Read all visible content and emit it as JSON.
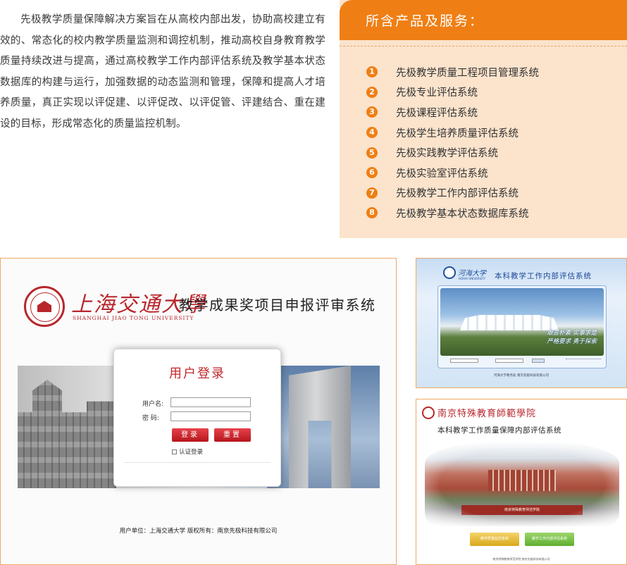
{
  "intro": {
    "text": "先极教学质量保障解决方案旨在从高校内部出发，协助高校建立有效的、常态化的校内教学质量监测和调控机制，推动高校自身教育教学质量持续改进与提高，通过高校教学工作内部评估系统及教学基本状态数据库的构建与运行，加强数据的动态监测和管理，保障和提高人才培养质量，真正实现以评促建、以评促改、以评促管、评建结合、重在建设的目标，形成常态化的质量监控机制。"
  },
  "products": {
    "heading": "所含产品及服务：",
    "accent_color": "#ef7f14",
    "panel_color": "#fbe3cc",
    "items": [
      {
        "num": "1",
        "label": "先极教学质量工程项目管理系统"
      },
      {
        "num": "2",
        "label": "先极专业评估系统"
      },
      {
        "num": "3",
        "label": "先极课程评估系统"
      },
      {
        "num": "4",
        "label": "先极学生培养质量评估系统"
      },
      {
        "num": "5",
        "label": "先极实践教学评估系统"
      },
      {
        "num": "6",
        "label": "先极实验室评估系统"
      },
      {
        "num": "7",
        "label": "先极教学工作内部评估系统"
      },
      {
        "num": "8",
        "label": "先极教学基本状态数据库系统"
      }
    ]
  },
  "screens": {
    "sjtu": {
      "logo_cn": "上海交通大學",
      "logo_en": "SHANGHAI JIAO TONG UNIVERSITY",
      "title": "教学成果奖项目申报评审系统",
      "login_title": "用户登录",
      "username_label": "用户名:",
      "password_label": "密 码:",
      "login_button": "登录",
      "reset_button": "重置",
      "remember_label": "认证登录",
      "footer": "用户单位：上海交通大学   版权所有：南京先极科技有限公司"
    },
    "hohai": {
      "school_cn": "河海大学",
      "school_en": "HOHAI UNIVERSITY",
      "title": "本科教学工作内部评估系统",
      "slogan_1": "艰苦朴素 实事求是",
      "slogan_2": "严格要求 勇于探索",
      "footer": "河海大学教务处 南京先极科技有限公司"
    },
    "njts": {
      "school_cn": "南京特殊教育師範學院",
      "title": "本科教学工作质量保障内部评估系统",
      "gate_text": "南京特殊教育师范学院",
      "btn_1": "教学质量监控系统",
      "btn_2": "教学工作内部评估系统",
      "footer": "南京特殊教育师范学院 南京先极科技有限公司"
    }
  }
}
